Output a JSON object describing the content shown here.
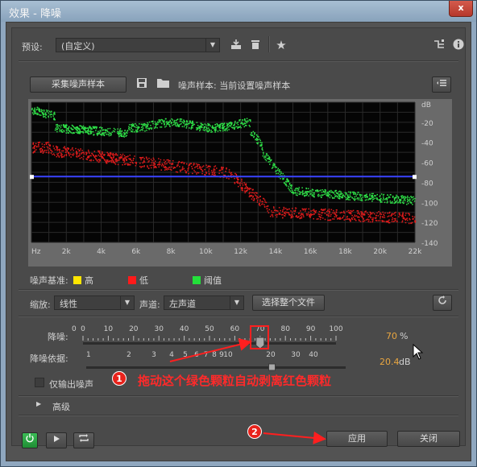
{
  "window": {
    "title": "效果 - 降噪",
    "close_glyph": "x"
  },
  "preset": {
    "label": "预设:",
    "value": "(自定义)"
  },
  "capture": {
    "button": "采集噪声样本",
    "sample_label": "噪声样本: 当前设置噪声样本"
  },
  "graph": {
    "db_labels": [
      "dB",
      "-20",
      "-40",
      "-60",
      "-80",
      "-100",
      "-120",
      "-140"
    ],
    "hz_labels": [
      "Hz",
      "2k",
      "4k",
      "6k",
      "8k",
      "10k",
      "12k",
      "14k",
      "16k",
      "18k",
      "20k",
      "22k"
    ]
  },
  "legend": {
    "title": "噪声基准:",
    "items": [
      {
        "label": "高",
        "color": "#ffe600"
      },
      {
        "label": "低",
        "color": "#ff1a1a"
      },
      {
        "label": "阈值",
        "color": "#23e03a"
      }
    ]
  },
  "scale": {
    "label": "缩放:",
    "value": "线性"
  },
  "channel": {
    "label": "声道:",
    "value": "左声道"
  },
  "select_all_button": "选择整个文件",
  "reduction": {
    "label": "降噪:",
    "ticks": [
      "0",
      "0",
      "10",
      "20",
      "30",
      "40",
      "50",
      "60",
      "70",
      "80",
      "90",
      "100"
    ],
    "value": "70",
    "unit": "%",
    "level": 70
  },
  "reduce_by": {
    "label": "降噪依据:",
    "ticks": [
      "1",
      "2",
      "3",
      "4",
      "5",
      "6",
      "7",
      "8",
      "9",
      "10",
      "20",
      "30",
      "40"
    ],
    "value": "20.4",
    "unit": "dB"
  },
  "output_noise_only": "仅输出噪声",
  "advanced": "高级",
  "annotations": {
    "one": "1",
    "one_text": "拖动这个绿色颗粒自动剥离红色颗粒",
    "two": "2"
  },
  "footer": {
    "apply": "应用",
    "close": "关闭"
  },
  "colors": {
    "graph_bg": "#050505",
    "threshold_line": "#3a44ff",
    "accent_value": "#e9a640"
  }
}
